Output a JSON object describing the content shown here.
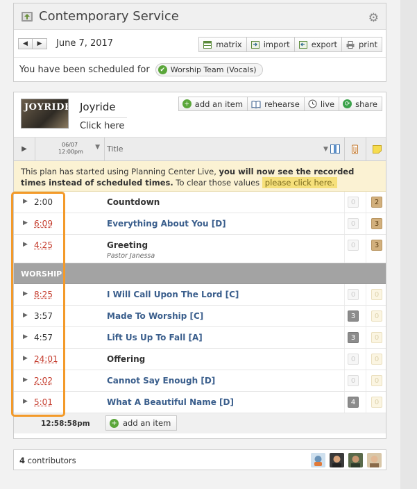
{
  "header": {
    "title": "Contemporary Service",
    "date": "June 7, 2017",
    "tools": [
      "matrix",
      "import",
      "export",
      "print"
    ],
    "scheduled_prefix": "You have been scheduled for",
    "scheduled_badge": "Worship Team (Vocals)"
  },
  "plan": {
    "thumb_text": "JOYRIDE",
    "series_title": "Joyride",
    "click_here": "Click here",
    "buttons": [
      "add an item",
      "rehearse",
      "live",
      "share"
    ],
    "columns": {
      "date": "06/07",
      "time": "12:00pm",
      "title": "Title"
    },
    "notice": {
      "part1": "This plan has started using Planning Center Live, ",
      "part2": "you will now see the recorded times instead of scheduled times.",
      "part3": " To clear those values ",
      "link": "please click here."
    },
    "items": [
      {
        "length": "2:00",
        "title": "Countdown",
        "attachments": "0",
        "notes": "2"
      },
      {
        "length": "6:09",
        "title": "Everything About You [D]",
        "attachments": "0",
        "notes": "3"
      },
      {
        "length": "4:25",
        "title": "Greeting",
        "subtitle": "Pastor Janessa",
        "attachments": "0",
        "notes": "3"
      },
      {
        "section": "WORSHIP"
      },
      {
        "length": "8:25",
        "title": "I Will Call Upon The Lord [C]",
        "attachments": "0",
        "notes": "0"
      },
      {
        "length": "3:57",
        "title": "Made To Worship [C]",
        "attachments": "3",
        "notes": "0"
      },
      {
        "length": "4:57",
        "title": "Lift Us Up To Fall [A]",
        "attachments": "3",
        "notes": "0"
      },
      {
        "length": "24:01",
        "title": "Offering",
        "attachments": "0",
        "notes": "0"
      },
      {
        "length": "2:02",
        "title": "Cannot Say Enough [D]",
        "attachments": "0",
        "notes": "0"
      },
      {
        "length": "5:01",
        "title": "What A Beautiful Name [D]",
        "attachments": "4",
        "notes": "0"
      }
    ],
    "end_time": "12:58:58pm",
    "footer_add": "add an item"
  },
  "contributors": {
    "count": "4",
    "label": " contributors"
  },
  "colors": {
    "accent_orange": "#f39a2a",
    "song_blue": "#3a5e8c",
    "time_red": "#c43a2b",
    "notice_bg": "#fbf2d3"
  }
}
